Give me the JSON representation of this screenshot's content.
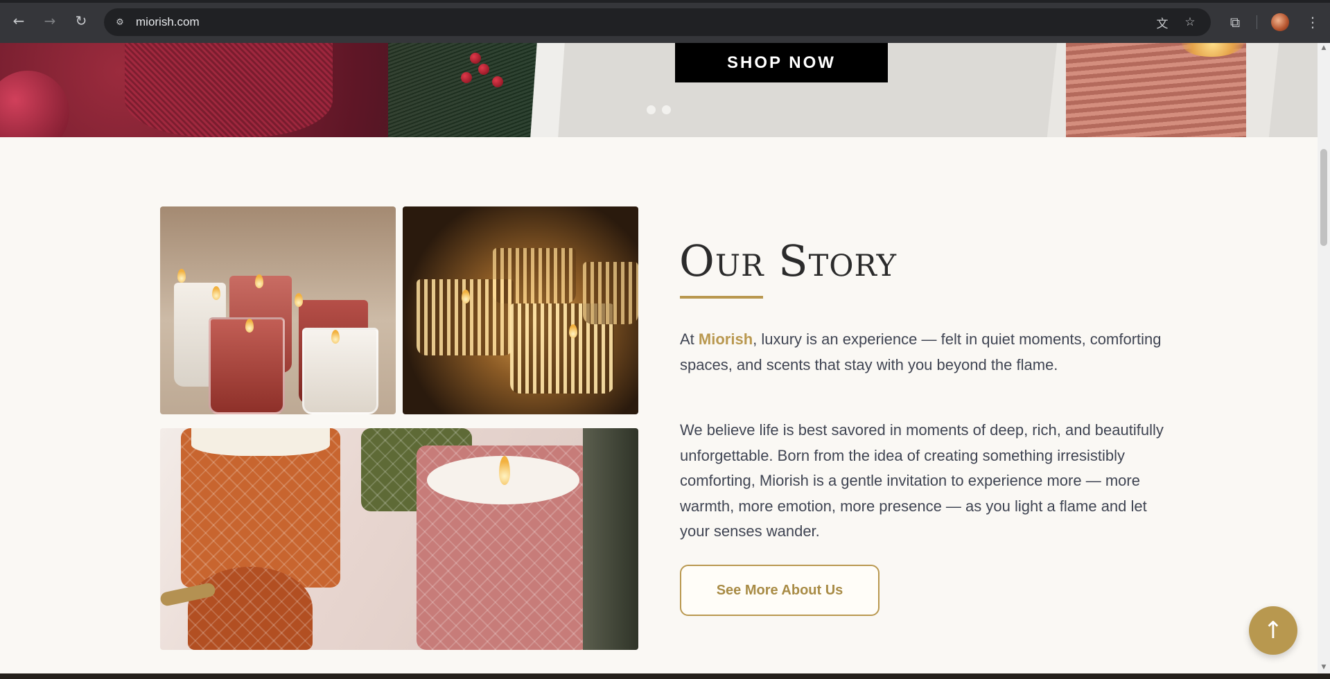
{
  "browser": {
    "url": "miorish.com",
    "back_icon": "←",
    "forward_icon": "→",
    "reload_icon": "↻",
    "site_info_icon": "⚙",
    "translate_icon": "文",
    "bookmark_icon": "☆",
    "extensions_icon": "⧉",
    "menu_icon": "⋮"
  },
  "hero": {
    "shop_now_label": "SHOP NOW",
    "slide_count": 2
  },
  "story": {
    "title": "Our Story",
    "para1_prefix": "At ",
    "brand_name": "Miorish",
    "para1_suffix": ", luxury is an experience — felt in quiet moments, comforting spaces, and scents that stay with you beyond the flame.",
    "para2": "We believe life is best savored in moments of deep, rich, and beautifully unforgettable. Born from the idea of creating something irresistibly comforting, Miorish is a gentle invitation to experience more — more warmth, more emotion, more presence — as you light a flame and let your senses wander.",
    "cta_label": "See More About Us"
  },
  "back_to_top_icon": "↑",
  "colors": {
    "accent": "#b9984f",
    "text": "#3f4452",
    "heading": "#2b2b2b",
    "background": "#faf8f4"
  }
}
